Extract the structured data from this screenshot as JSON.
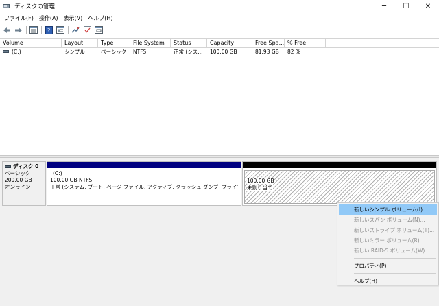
{
  "window": {
    "title": "ディスクの管理",
    "icon": "disk-management-icon",
    "controls": {
      "minimize": "─",
      "maximize": "☐",
      "close": "✕"
    }
  },
  "menubar": [
    "ファイル(F)",
    "操作(A)",
    "表示(V)",
    "ヘルプ(H)"
  ],
  "toolbar": [
    "back-arrow-icon",
    "forward-arrow-icon",
    "list-view-icon",
    "help-book-icon",
    "properties-icon",
    "connect-icon",
    "check-icon",
    "settings-window-icon"
  ],
  "volume_list": {
    "columns": [
      "Volume",
      "Layout",
      "Type",
      "File System",
      "Status",
      "Capacity",
      "Free Spa...",
      "% Free"
    ],
    "rows": [
      {
        "volume": "(C:)",
        "layout": "シンプル",
        "type": "ベーシック",
        "fs": "NTFS",
        "status": "正常 (シス...",
        "capacity": "100.00 GB",
        "free": "81.93 GB",
        "pct": "82 %"
      }
    ]
  },
  "disk": {
    "name": "ディスク 0",
    "type": "ベーシック",
    "size": "200.00 GB",
    "state": "オンライン"
  },
  "partitions": {
    "c": {
      "label": "(C:)",
      "size_fs": "100.00 GB NTFS",
      "status": "正常 (システム, ブート, ページ ファイル, アクティブ, クラッシュ ダンプ, プライマリ パーティション)",
      "bar_color": "#000080"
    },
    "unallocated": {
      "size": "100.00 GB",
      "label": "未割り当て",
      "bar_color": "#000000"
    }
  },
  "context_menu": {
    "items": [
      {
        "label": "新しいシンプル ボリューム(I)...",
        "enabled": true,
        "highlighted": true
      },
      {
        "label": "新しいスパン ボリューム(N)...",
        "enabled": false
      },
      {
        "label": "新しいストライプ ボリューム(T)...",
        "enabled": false
      },
      {
        "label": "新しいミラー ボリューム(R)...",
        "enabled": false
      },
      {
        "label": "新しい RAID-5 ボリューム(W)...",
        "enabled": false
      },
      {
        "label": "プロパティ(P)",
        "enabled": true,
        "separator_before": true
      },
      {
        "label": "ヘルプ(H)",
        "enabled": true,
        "separator_before": true
      }
    ],
    "highlight_color": "#91c9f7"
  }
}
